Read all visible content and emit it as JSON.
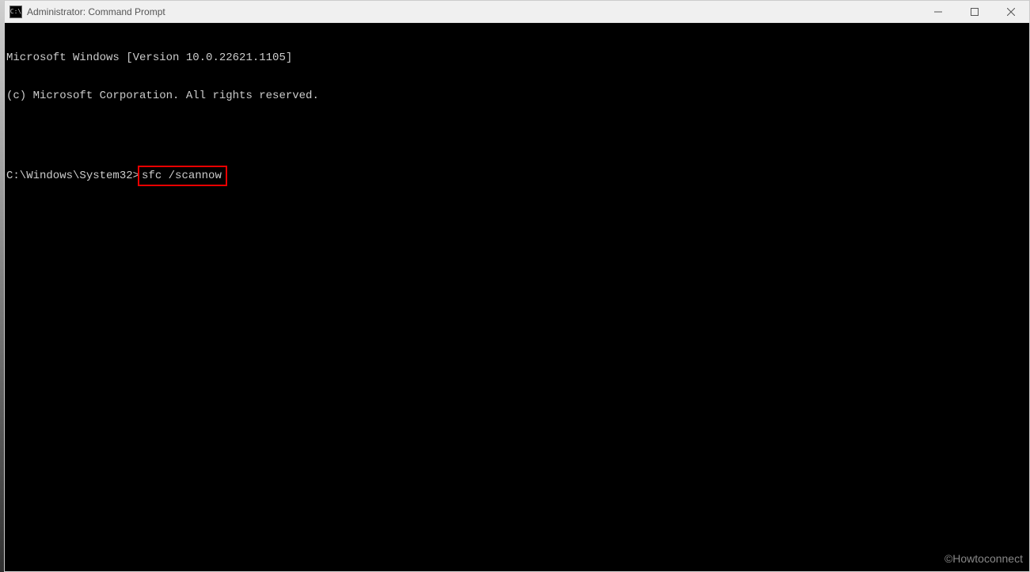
{
  "window": {
    "title": "Administrator: Command Prompt",
    "icon_label": "C:\\"
  },
  "terminal": {
    "line1": "Microsoft Windows [Version 10.0.22621.1105]",
    "line2": "(c) Microsoft Corporation. All rights reserved.",
    "prompt": "C:\\Windows\\System32>",
    "command": "sfc /scannow"
  },
  "watermark": "©Howtoconnect"
}
